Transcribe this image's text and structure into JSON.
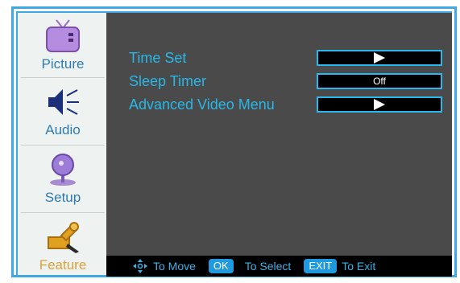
{
  "sidebar": {
    "items": [
      {
        "label": "Picture",
        "icon": "tv-icon"
      },
      {
        "label": "Audio",
        "icon": "speaker-icon"
      },
      {
        "label": "Setup",
        "icon": "setup-icon"
      },
      {
        "label": "Feature",
        "icon": "tools-icon",
        "active": true
      }
    ]
  },
  "menu": {
    "rows": [
      {
        "label": "Time Set",
        "value": "",
        "value_type": "arrow"
      },
      {
        "label": "Sleep Timer",
        "value": "Off",
        "value_type": "text"
      },
      {
        "label": "Advanced Video Menu",
        "value": "",
        "value_type": "arrow"
      }
    ]
  },
  "hints": {
    "move": "To Move",
    "ok_key": "OK",
    "select": "To Select",
    "exit_key": "EXIT",
    "exit": "To Exit"
  },
  "colors": {
    "accent": "#28b8e8",
    "panel": "#4a4a4a",
    "frame": "#3fa9e2",
    "active_label": "#d9a23a"
  }
}
